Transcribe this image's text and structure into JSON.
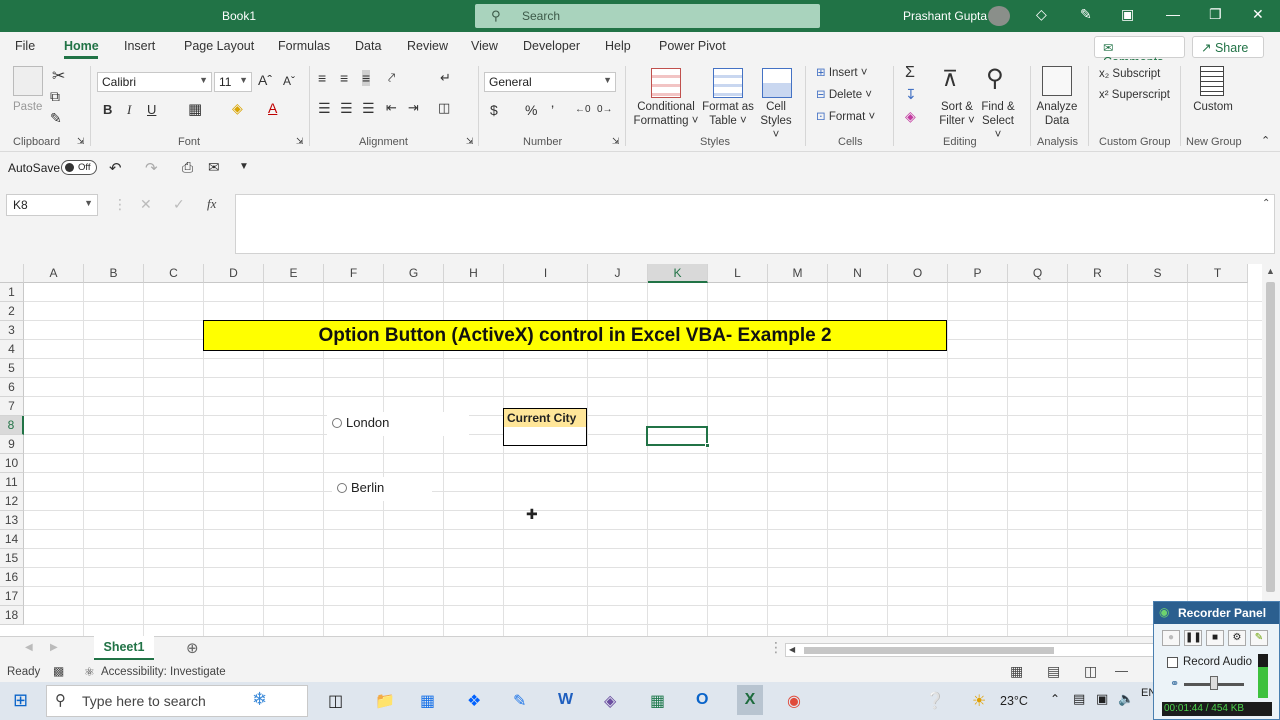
{
  "window": {
    "title": "Book1",
    "search_placeholder": "Search",
    "user_name": "Prashant Gupta"
  },
  "menu": {
    "tabs": [
      "File",
      "Home",
      "Insert",
      "Page Layout",
      "Formulas",
      "Data",
      "Review",
      "View",
      "Developer",
      "Help",
      "Power Pivot"
    ],
    "comments": "Comments",
    "share": "Share"
  },
  "ribbon": {
    "clipboard": {
      "paste": "Paste",
      "label": "Clipboard"
    },
    "font": {
      "name": "Calibri",
      "size": "11",
      "label": "Font"
    },
    "alignment": {
      "label": "Alignment"
    },
    "number": {
      "format": "General",
      "label": "Number"
    },
    "styles": {
      "conditional_1": "Conditional",
      "conditional_2": "Formatting",
      "format_table_1": "Format as",
      "format_table_2": "Table",
      "cell_styles_1": "Cell",
      "cell_styles_2": "Styles",
      "label": "Styles"
    },
    "cells": {
      "insert": "Insert",
      "delete": "Delete",
      "format": "Format",
      "label": "Cells"
    },
    "editing": {
      "sort_1": "Sort &",
      "sort_2": "Filter",
      "find_1": "Find &",
      "find_2": "Select",
      "label": "Editing"
    },
    "analysis": {
      "analyze_1": "Analyze",
      "analyze_2": "Data",
      "label": "Analysis"
    },
    "custom_group": {
      "subscript": "Subscript",
      "superscript": "Superscript",
      "label": "Custom Group"
    },
    "new_group": {
      "custom": "Custom",
      "label": "New Group"
    }
  },
  "qat": {
    "autosave": "AutoSave",
    "toggle": "Off"
  },
  "formula_bar": {
    "name_box": "K8",
    "fx": "fx",
    "value": ""
  },
  "sheet": {
    "columns": [
      "A",
      "B",
      "C",
      "D",
      "E",
      "F",
      "G",
      "H",
      "I",
      "J",
      "K",
      "L",
      "M",
      "N",
      "O",
      "P",
      "Q",
      "R",
      "S",
      "T"
    ],
    "rows": [
      "1",
      "2",
      "3",
      "4",
      "5",
      "6",
      "7",
      "8",
      "9",
      "10",
      "11",
      "12",
      "13",
      "14",
      "15",
      "16",
      "17",
      "18"
    ],
    "selected_column": "K",
    "selected_row": "8",
    "title_text": "Option Button (ActiveX) control in Excel VBA- Example 2",
    "option_london": "London",
    "option_berlin": "Berlin",
    "current_city_label": "Current City",
    "current_city_value": ""
  },
  "tabs": {
    "sheet1": "Sheet1"
  },
  "status": {
    "ready": "Ready",
    "accessibility": "Accessibility: Investigate"
  },
  "taskbar": {
    "search_placeholder": "Type here to search",
    "weather": "23°C",
    "lang": "EN"
  },
  "recorder": {
    "title": "Recorder Panel",
    "record_audio": "Record Audio",
    "timer": "00:01:44 / 454 KB"
  }
}
